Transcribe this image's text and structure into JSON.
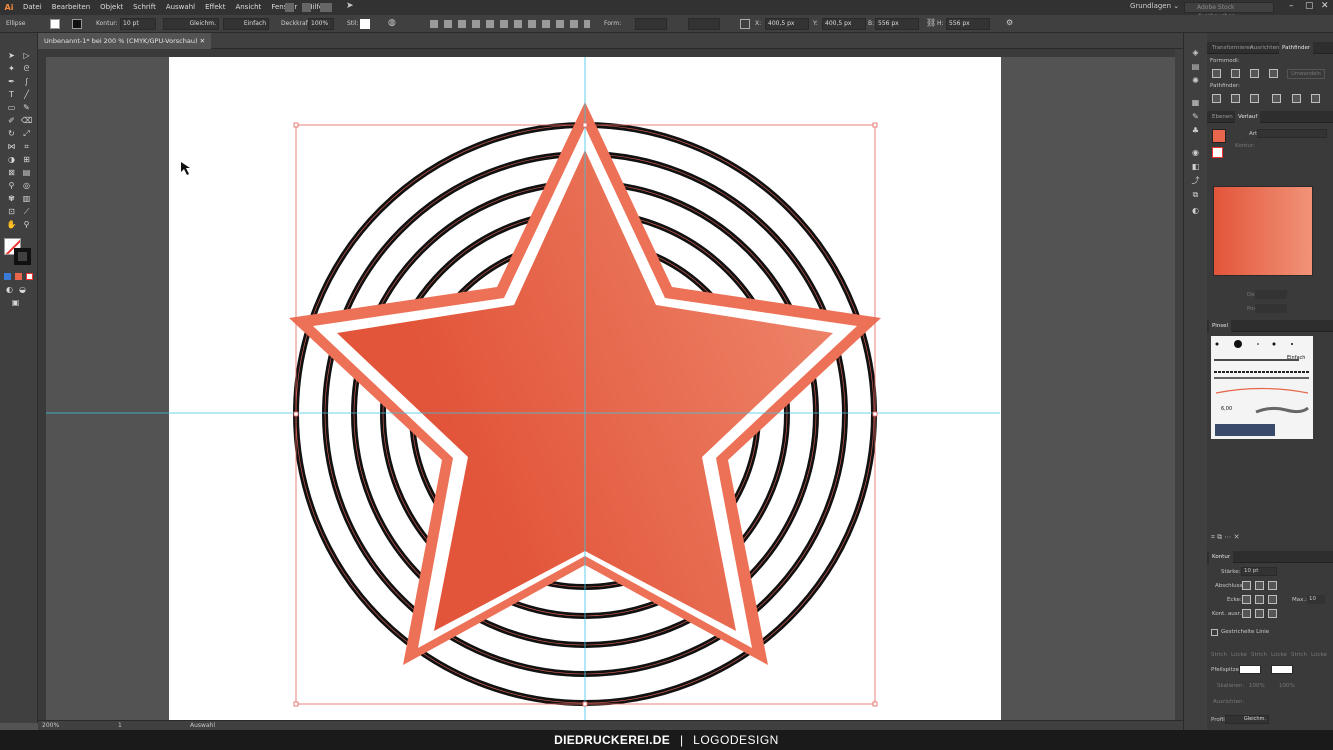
{
  "app": {
    "logo": "Ai"
  },
  "menu": [
    "Datei",
    "Bearbeiten",
    "Objekt",
    "Schrift",
    "Auswahl",
    "Effekt",
    "Ansicht",
    "Fenster",
    "Hilfe"
  ],
  "workspace": "Grundlagen",
  "stock_search_placeholder": "Adobe Stock durchsuchen",
  "control": {
    "selection": "Ellipse",
    "stroke_label": "Kontur:",
    "stroke_weight": "10 pt",
    "profile1": "Gleichm.",
    "profile2": "Einfach",
    "opacity_label": "Deckkraft:",
    "opacity": "100%",
    "style_label": "Stil:",
    "shape_label": "Form:",
    "x_label": "X:",
    "x": "400,5 px",
    "y_label": "Y:",
    "y": "400,5 px",
    "w_label": "B:",
    "w": "556 px",
    "h_label": "H:",
    "h": "556 px"
  },
  "document_tab": "Unbenannt-1* bei 200 % (CMYK/GPU-Vorschau)",
  "status": {
    "zoom": "200%",
    "artboard": "1",
    "mode": "Auswahl"
  },
  "panels": {
    "top_tabs": [
      "Transformieren",
      "Ausrichten",
      "Pathfinder"
    ],
    "formmodi": "Formmodi:",
    "umwandeln": "Umwandeln",
    "pathfinder": "Pathfinder:",
    "mid_tabs": [
      "Ebenen",
      "Verlauf"
    ],
    "art_label": "Art:",
    "kontur_label": "Kontur:",
    "deckkraft": "Deckkraft:",
    "position": "Position:",
    "pinsel_title": "Pinsel",
    "brush_einfach": "Einfach",
    "brush_size": "6,00",
    "kontur_title": "Kontur",
    "staerke_label": "Stärke:",
    "staerke": "10 pt",
    "abschluss": "Abschluss:",
    "ecke": "Ecke:",
    "max_label": "Max.:",
    "max_value": "10",
    "kont_ausr": "Kont. ausr.:",
    "gestrichelt": "Gestrichelte Linie",
    "dash_labels": [
      "Strich",
      "Lücke",
      "Strich",
      "Lücke",
      "Strich",
      "Lücke"
    ],
    "pfeilspitzen": "Pfeilspitzen:",
    "skalieren": "Skalieren:",
    "scale1": "100%",
    "scale2": "100%",
    "ausrichten": "Ausrichten:",
    "profil": "Profil:",
    "profil_value": "Gleichm."
  },
  "colors": {
    "star": "#e85f44",
    "star_light": "#f0917a",
    "ring": "#111111",
    "guide": "#39c4e8",
    "selection": "#e2655a"
  },
  "footer": {
    "brand": "DIEDRUCKEREI.DE",
    "separator": "|",
    "subtitle": "LOGODESIGN"
  }
}
